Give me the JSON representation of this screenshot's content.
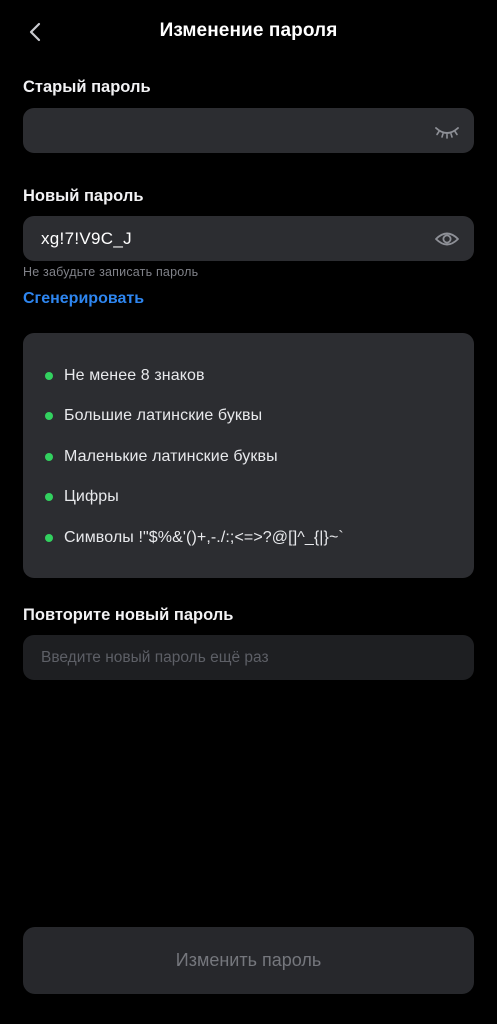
{
  "header": {
    "title": "Изменение пароля",
    "back_icon": "chevron-left-icon"
  },
  "old_password": {
    "label": "Старый пароль",
    "value": "",
    "visibility_icon": "eye-closed-icon"
  },
  "new_password": {
    "label": "Новый пароль",
    "value": "xg!7!V9C_J",
    "visibility_icon": "eye-icon",
    "hint": "Не забудьте записать пароль",
    "generate_label": "Сгенерировать"
  },
  "requirements": {
    "items": [
      {
        "text": "Не менее 8 знаков",
        "met": true
      },
      {
        "text": "Большие латинские буквы",
        "met": true
      },
      {
        "text": "Маленькие латинские буквы",
        "met": true
      },
      {
        "text": "Цифры",
        "met": true
      },
      {
        "text": "Символы !\"$%&'()+,-./:;<=>?@[]^_{|}~`",
        "met": true
      }
    ]
  },
  "repeat_password": {
    "label": "Повторите новый пароль",
    "placeholder": "Введите новый пароль ещё раз",
    "value": ""
  },
  "submit": {
    "label": "Изменить пароль"
  },
  "colors": {
    "background": "#000000",
    "field": "#2c2d31",
    "accent_link": "#2e86f0",
    "requirement_met": "#32d15f",
    "button_disabled": "#27282c"
  }
}
